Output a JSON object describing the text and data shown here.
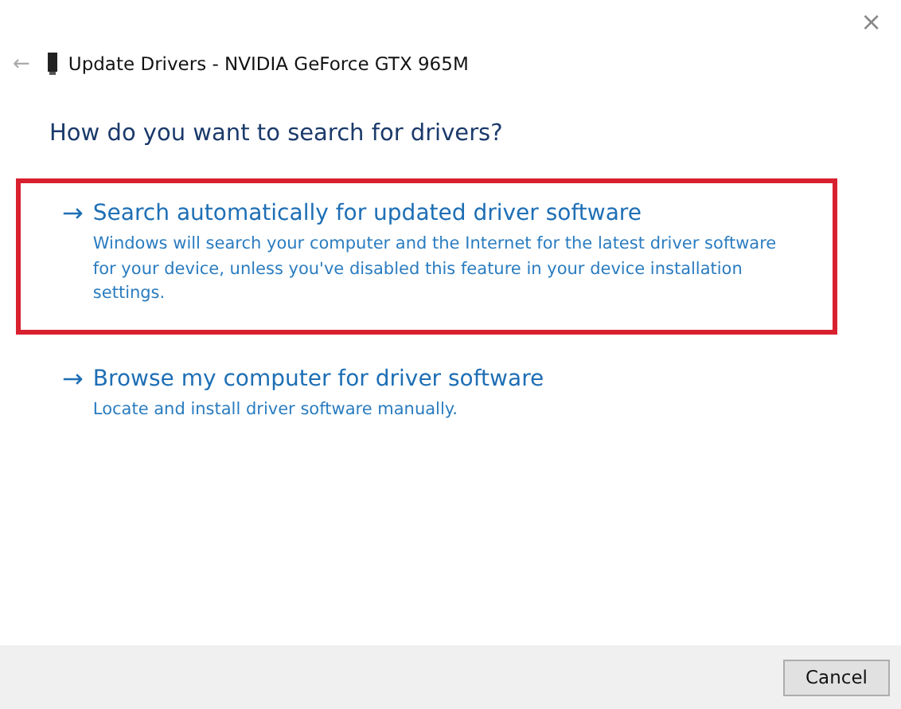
{
  "window": {
    "title": "Update Drivers - NVIDIA GeForce GTX 965M",
    "close": "×",
    "back": "←"
  },
  "heading": "How do you want to search for drivers?",
  "options": [
    {
      "arrow": "→",
      "title": "Search automatically for updated driver software",
      "description": "Windows will search your computer and the Internet for the latest driver software for your device, unless you've disabled this feature in your device installation settings.",
      "highlighted": true
    },
    {
      "arrow": "→",
      "title": "Browse my computer for driver software",
      "description": "Locate and install driver software manually.",
      "highlighted": false
    }
  ],
  "buttons": [
    "Cancel"
  ]
}
